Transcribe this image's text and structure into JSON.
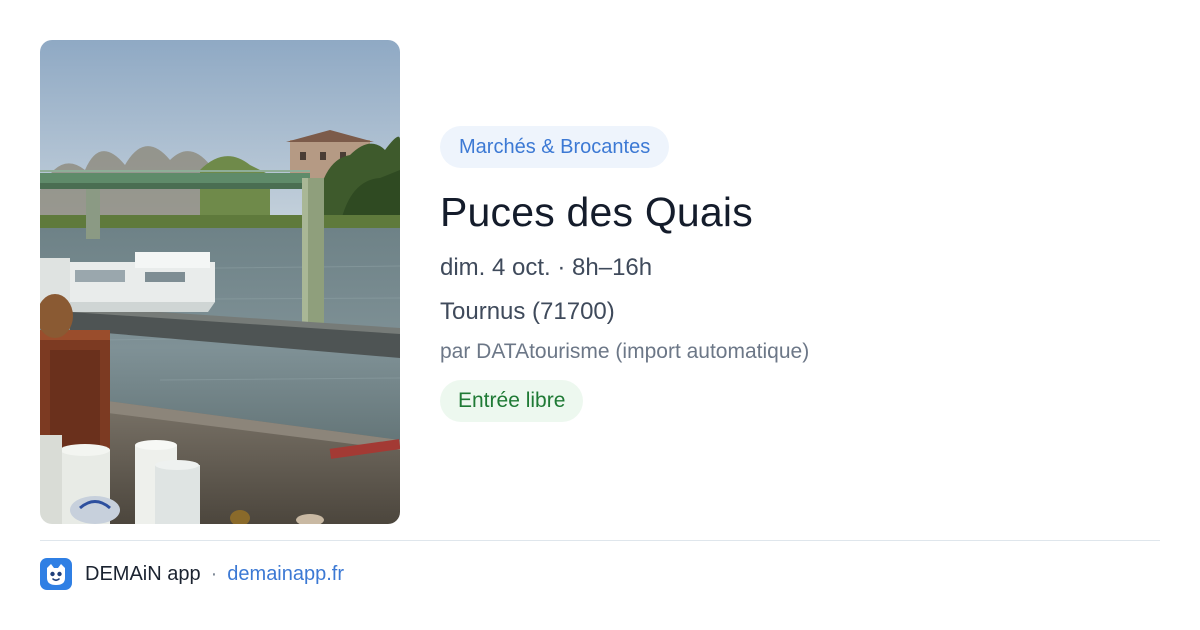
{
  "event": {
    "category": "Marchés & Brocantes",
    "title": "Puces des Quais",
    "when": "dim. 4 oct. · 8h–16h",
    "where": "Tournus (71700)",
    "source": "par DATAtourisme (import automatique)",
    "price": "Entrée libre",
    "photo_subject": "river-quay-flea-market-photo"
  },
  "footer": {
    "brand": "DEMAiN app",
    "separator": "·",
    "site": "demainapp.fr",
    "logo_icon": "demain-app-logo-icon"
  },
  "colors": {
    "accent": "#3c79d4",
    "category_bg": "#eef4fc",
    "price_text": "#1f7a35",
    "price_bg": "#edf8ef",
    "title": "#141c2b"
  }
}
